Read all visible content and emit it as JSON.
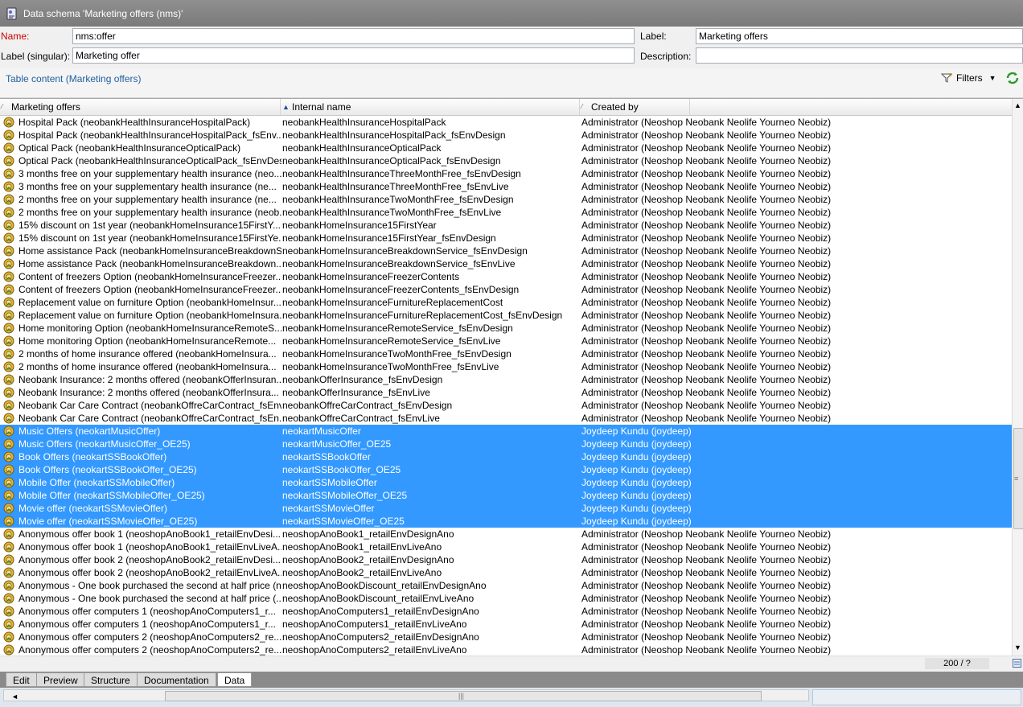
{
  "window": {
    "title": "Data schema 'Marketing offers (nms)'"
  },
  "form": {
    "name_label": "Name:",
    "name_value": "nms:offer",
    "label_label": "Label:",
    "label_value": "Marketing offers",
    "singular_label": "Label (singular):",
    "singular_value": "Marketing offer",
    "description_label": "Description:",
    "description_value": ""
  },
  "section": {
    "title": "Table content (Marketing offers)",
    "filters_label": "Filters"
  },
  "grid": {
    "columns": [
      "Marketing offers",
      "Internal name",
      "Created by"
    ],
    "rows": [
      {
        "label": "Hospital Pack (neobankHealthInsuranceHospitalPack)",
        "name": "neobankHealthInsuranceHospitalPack",
        "creator": "Administrator (Neoshop Neobank Neolife Yourneo Neobiz)",
        "selected": false
      },
      {
        "label": "Hospital Pack (neobankHealthInsuranceHospitalPack_fsEnv...",
        "name": "neobankHealthInsuranceHospitalPack_fsEnvDesign",
        "creator": "Administrator (Neoshop Neobank Neolife Yourneo Neobiz)",
        "selected": false
      },
      {
        "label": "Optical Pack (neobankHealthInsuranceOpticalPack)",
        "name": "neobankHealthInsuranceOpticalPack",
        "creator": "Administrator (Neoshop Neobank Neolife Yourneo Neobiz)",
        "selected": false
      },
      {
        "label": "Optical Pack (neobankHealthInsuranceOpticalPack_fsEnvDes...",
        "name": "neobankHealthInsuranceOpticalPack_fsEnvDesign",
        "creator": "Administrator (Neoshop Neobank Neolife Yourneo Neobiz)",
        "selected": false
      },
      {
        "label": "3 months free on your supplementary health insurance (neo...",
        "name": "neobankHealthInsuranceThreeMonthFree_fsEnvDesign",
        "creator": "Administrator (Neoshop Neobank Neolife Yourneo Neobiz)",
        "selected": false
      },
      {
        "label": "3 months free on your supplementary health insurance (ne...",
        "name": "neobankHealthInsuranceThreeMonthFree_fsEnvLive",
        "creator": "Administrator (Neoshop Neobank Neolife Yourneo Neobiz)",
        "selected": false
      },
      {
        "label": "2 months free on your supplementary health insurance (ne...",
        "name": "neobankHealthInsuranceTwoMonthFree_fsEnvDesign",
        "creator": "Administrator (Neoshop Neobank Neolife Yourneo Neobiz)",
        "selected": false
      },
      {
        "label": "2 months free on your supplementary health insurance (neob...",
        "name": "neobankHealthInsuranceTwoMonthFree_fsEnvLive",
        "creator": "Administrator (Neoshop Neobank Neolife Yourneo Neobiz)",
        "selected": false
      },
      {
        "label": "15% discount on 1st year (neobankHomeInsurance15FirstY...",
        "name": "neobankHomeInsurance15FirstYear",
        "creator": "Administrator (Neoshop Neobank Neolife Yourneo Neobiz)",
        "selected": false
      },
      {
        "label": "15% discount on 1st year (neobankHomeInsurance15FirstYe...",
        "name": "neobankHomeInsurance15FirstYear_fsEnvDesign",
        "creator": "Administrator (Neoshop Neobank Neolife Yourneo Neobiz)",
        "selected": false
      },
      {
        "label": "Home assistance Pack (neobankHomeInsuranceBreakdownS...",
        "name": "neobankHomeInsuranceBreakdownService_fsEnvDesign",
        "creator": "Administrator (Neoshop Neobank Neolife Yourneo Neobiz)",
        "selected": false
      },
      {
        "label": "Home assistance Pack (neobankHomeInsuranceBreakdown...",
        "name": "neobankHomeInsuranceBreakdownService_fsEnvLive",
        "creator": "Administrator (Neoshop Neobank Neolife Yourneo Neobiz)",
        "selected": false
      },
      {
        "label": "Content of freezers Option (neobankHomeInsuranceFreezer...",
        "name": "neobankHomeInsuranceFreezerContents",
        "creator": "Administrator (Neoshop Neobank Neolife Yourneo Neobiz)",
        "selected": false
      },
      {
        "label": "Content of freezers Option (neobankHomeInsuranceFreezer...",
        "name": "neobankHomeInsuranceFreezerContents_fsEnvDesign",
        "creator": "Administrator (Neoshop Neobank Neolife Yourneo Neobiz)",
        "selected": false
      },
      {
        "label": "Replacement value on furniture Option (neobankHomeInsur...",
        "name": "neobankHomeInsuranceFurnitureReplacementCost",
        "creator": "Administrator (Neoshop Neobank Neolife Yourneo Neobiz)",
        "selected": false
      },
      {
        "label": "Replacement value on furniture Option (neobankHomeInsura...",
        "name": "neobankHomeInsuranceFurnitureReplacementCost_fsEnvDesign",
        "creator": "Administrator (Neoshop Neobank Neolife Yourneo Neobiz)",
        "selected": false
      },
      {
        "label": "Home monitoring Option (neobankHomeInsuranceRemoteS...",
        "name": "neobankHomeInsuranceRemoteService_fsEnvDesign",
        "creator": "Administrator (Neoshop Neobank Neolife Yourneo Neobiz)",
        "selected": false
      },
      {
        "label": "Home monitoring Option (neobankHomeInsuranceRemote...",
        "name": "neobankHomeInsuranceRemoteService_fsEnvLive",
        "creator": "Administrator (Neoshop Neobank Neolife Yourneo Neobiz)",
        "selected": false
      },
      {
        "label": "2 months of home insurance offered (neobankHomeInsura...",
        "name": "neobankHomeInsuranceTwoMonthFree_fsEnvDesign",
        "creator": "Administrator (Neoshop Neobank Neolife Yourneo Neobiz)",
        "selected": false
      },
      {
        "label": "2 months of home insurance offered (neobankHomeInsura...",
        "name": "neobankHomeInsuranceTwoMonthFree_fsEnvLive",
        "creator": "Administrator (Neoshop Neobank Neolife Yourneo Neobiz)",
        "selected": false
      },
      {
        "label": "Neobank Insurance: 2 months offered (neobankOfferInsuran...",
        "name": "neobankOfferInsurance_fsEnvDesign",
        "creator": "Administrator (Neoshop Neobank Neolife Yourneo Neobiz)",
        "selected": false
      },
      {
        "label": "Neobank Insurance: 2 months offered (neobankOfferInsura...",
        "name": "neobankOfferInsurance_fsEnvLive",
        "creator": "Administrator (Neoshop Neobank Neolife Yourneo Neobiz)",
        "selected": false
      },
      {
        "label": "Neobank Car Care Contract (neobankOffreCarContract_fsEnv...",
        "name": "neobankOffreCarContract_fsEnvDesign",
        "creator": "Administrator (Neoshop Neobank Neolife Yourneo Neobiz)",
        "selected": false
      },
      {
        "label": "Neobank Car Care Contract (neobankOffreCarContract_fsEn...",
        "name": "neobankOffreCarContract_fsEnvLive",
        "creator": "Administrator (Neoshop Neobank Neolife Yourneo Neobiz)",
        "selected": false
      },
      {
        "label": "Music Offers (neokartMusicOffer)",
        "name": "neokartMusicOffer",
        "creator": "Joydeep Kundu (joydeep)",
        "selected": true
      },
      {
        "label": "Music Offers (neokartMusicOffer_OE25)",
        "name": "neokartMusicOffer_OE25",
        "creator": "Joydeep Kundu (joydeep)",
        "selected": true
      },
      {
        "label": "Book Offers (neokartSSBookOffer)",
        "name": "neokartSSBookOffer",
        "creator": "Joydeep Kundu (joydeep)",
        "selected": true
      },
      {
        "label": "Book Offers (neokartSSBookOffer_OE25)",
        "name": "neokartSSBookOffer_OE25",
        "creator": "Joydeep Kundu (joydeep)",
        "selected": true
      },
      {
        "label": "Mobile Offer (neokartSSMobileOffer)",
        "name": "neokartSSMobileOffer",
        "creator": "Joydeep Kundu (joydeep)",
        "selected": true
      },
      {
        "label": "Mobile Offer (neokartSSMobileOffer_OE25)",
        "name": "neokartSSMobileOffer_OE25",
        "creator": "Joydeep Kundu (joydeep)",
        "selected": true
      },
      {
        "label": "Movie offer (neokartSSMovieOffer)",
        "name": "neokartSSMovieOffer",
        "creator": "Joydeep Kundu (joydeep)",
        "selected": true
      },
      {
        "label": "Movie offer (neokartSSMovieOffer_OE25)",
        "name": "neokartSSMovieOffer_OE25",
        "creator": "Joydeep Kundu (joydeep)",
        "selected": true
      },
      {
        "label": "Anonymous offer book 1 (neoshopAnoBook1_retailEnvDesi...",
        "name": "neoshopAnoBook1_retailEnvDesignAno",
        "creator": "Administrator (Neoshop Neobank Neolife Yourneo Neobiz)",
        "selected": false
      },
      {
        "label": "Anonymous offer book 1 (neoshopAnoBook1_retailEnvLiveA...",
        "name": "neoshopAnoBook1_retailEnvLiveAno",
        "creator": "Administrator (Neoshop Neobank Neolife Yourneo Neobiz)",
        "selected": false
      },
      {
        "label": "Anonymous offer book 2 (neoshopAnoBook2_retailEnvDesi...",
        "name": "neoshopAnoBook2_retailEnvDesignAno",
        "creator": "Administrator (Neoshop Neobank Neolife Yourneo Neobiz)",
        "selected": false
      },
      {
        "label": "Anonymous offer book 2 (neoshopAnoBook2_retailEnvLiveA...",
        "name": "neoshopAnoBook2_retailEnvLiveAno",
        "creator": "Administrator (Neoshop Neobank Neolife Yourneo Neobiz)",
        "selected": false
      },
      {
        "label": "Anonymous - One book purchased the second at half price (n",
        "name": "neoshopAnoBookDiscount_retailEnvDesignAno",
        "creator": "Administrator (Neoshop Neobank Neolife Yourneo Neobiz)",
        "selected": false
      },
      {
        "label": "Anonymous - One book purchased the second at half price (...",
        "name": "neoshopAnoBookDiscount_retailEnvLiveAno",
        "creator": "Administrator (Neoshop Neobank Neolife Yourneo Neobiz)",
        "selected": false
      },
      {
        "label": "Anonymous offer computers 1 (neoshopAnoComputers1_r...",
        "name": "neoshopAnoComputers1_retailEnvDesignAno",
        "creator": "Administrator (Neoshop Neobank Neolife Yourneo Neobiz)",
        "selected": false
      },
      {
        "label": "Anonymous offer computers 1 (neoshopAnoComputers1_r...",
        "name": "neoshopAnoComputers1_retailEnvLiveAno",
        "creator": "Administrator (Neoshop Neobank Neolife Yourneo Neobiz)",
        "selected": false
      },
      {
        "label": "Anonymous offer computers 2  (neoshopAnoComputers2_re...",
        "name": "neoshopAnoComputers2_retailEnvDesignAno",
        "creator": "Administrator (Neoshop Neobank Neolife Yourneo Neobiz)",
        "selected": false
      },
      {
        "label": "Anonymous offer computers 2  (neoshopAnoComputers2_re...",
        "name": "neoshopAnoComputers2_retailEnvLiveAno",
        "creator": "Administrator (Neoshop Neobank Neolife Yourneo Neobiz)",
        "selected": false
      }
    ],
    "count": "200 / ?"
  },
  "tabs": [
    {
      "label": "Edit",
      "active": false
    },
    {
      "label": "Preview",
      "active": false
    },
    {
      "label": "Structure",
      "active": false
    },
    {
      "label": "Documentation",
      "active": false
    },
    {
      "label": "Data",
      "active": true
    }
  ],
  "colors": {
    "selection": "#3399ff",
    "title_bar": "#808080",
    "section_title": "#1f5f9f",
    "required_label": "#cc0000"
  }
}
